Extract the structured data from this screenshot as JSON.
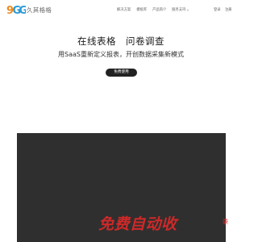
{
  "header": {
    "logo_text": "久其格格",
    "nav_items": [
      {
        "label": "解决方案",
        "has_dropdown": false
      },
      {
        "label": "模板库",
        "has_dropdown": false
      },
      {
        "label": "产品简介",
        "has_dropdown": false
      },
      {
        "label": "服务支持",
        "has_dropdown": true
      }
    ],
    "login_label": "登录",
    "register_label": "注册"
  },
  "hero": {
    "title": "在线表格　问卷调查",
    "subtitle": "用SaaS重新定义报表，开创数据采集新模式",
    "cta_label": "免费使用"
  },
  "watermark": {
    "text": "免费自动收",
    "suffix": "录"
  },
  "colors": {
    "logo_orange": "#f08a1c",
    "logo_blue": "#2a9ad6",
    "cta_bg": "#222222",
    "preview_bg": "#2f2f2f",
    "watermark": "#e62828"
  }
}
